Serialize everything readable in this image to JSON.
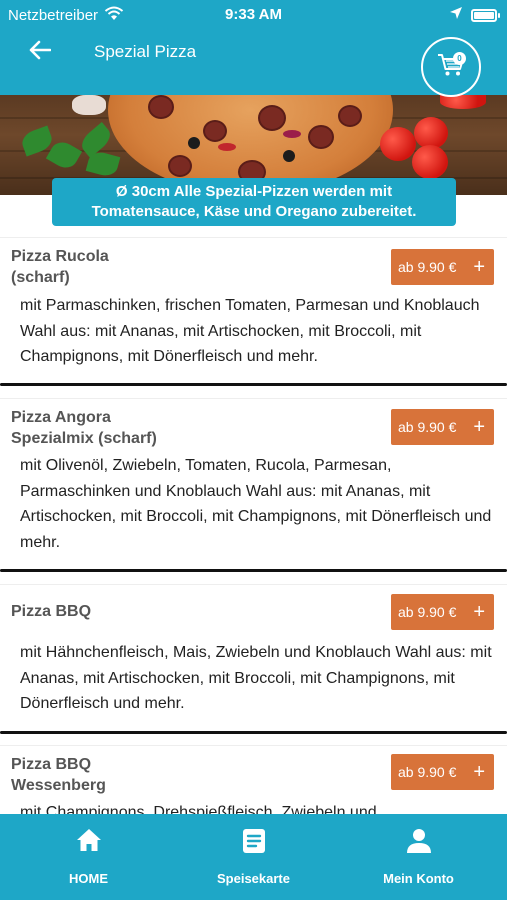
{
  "status_bar": {
    "carrier": "Netzbetreiber",
    "time": "9:33 AM",
    "icons": [
      "wifi-icon",
      "location-arrow-icon",
      "battery-icon"
    ]
  },
  "nav": {
    "title": "Spezial Pizza",
    "cart_count": "0",
    "icons": [
      "back-arrow-icon",
      "cart-icon"
    ]
  },
  "banner": {
    "info_line1": "Ø 30cm Alle Spezial-Pizzen werden mit",
    "info_line2": "Tomatensauce, Käse und Oregano zubereitet."
  },
  "items": [
    {
      "name": "Pizza Rucola\n(scharf)",
      "price": "ab 9.90 €",
      "description": "mit Parmaschinken, frischen Tomaten, Parmesan und Knoblauch Wahl aus: mit Ananas, mit Artischocken, mit Broccoli, mit Champignons, mit Dönerfleisch und mehr."
    },
    {
      "name": "Pizza Angora\nSpezialmix (scharf)",
      "price": "ab 9.90 €",
      "description": "mit Olivenöl, Zwiebeln, Tomaten, Rucola, Parmesan, Parmaschinken und Knoblauch Wahl aus: mit Ananas, mit Artischocken, mit Broccoli, mit Champignons, mit Dönerfleisch und mehr."
    },
    {
      "name": "Pizza BBQ",
      "price": "ab 9.90 €",
      "description": "mit Hähnchenfleisch, Mais, Zwiebeln und Knoblauch Wahl aus: mit Ananas, mit Artischocken, mit Broccoli, mit Champignons, mit Dönerfleisch und mehr."
    },
    {
      "name": "Pizza BBQ\nWessenberg",
      "price": "ab 9.90 €",
      "description": "mit Champignons, Drehspießfleisch, Zwiebeln und"
    }
  ],
  "tabbar": {
    "home": "HOME",
    "menu": "Speisekarte",
    "account": "Mein Konto",
    "icons": [
      "home-icon",
      "menu-list-icon",
      "user-icon"
    ]
  },
  "colors": {
    "primary": "#1ea7c7",
    "price_button": "#d8733a",
    "white": "#ffffff"
  }
}
